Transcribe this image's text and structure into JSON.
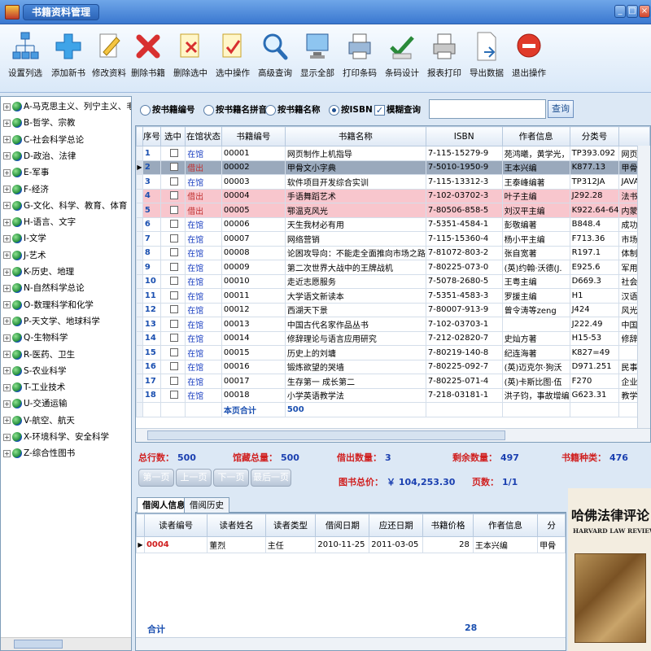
{
  "window": {
    "title": "书籍资料管理"
  },
  "toolbar": [
    {
      "label": "设置列选",
      "icon": "column-settings-icon"
    },
    {
      "label": "添加新书",
      "icon": "add-icon"
    },
    {
      "label": "修改资料",
      "icon": "edit-icon"
    },
    {
      "label": "删除书籍",
      "icon": "delete-icon"
    },
    {
      "label": "删除选中",
      "icon": "delete-selected-icon"
    },
    {
      "label": "选中操作",
      "icon": "check-operation-icon"
    },
    {
      "label": "高级查询",
      "icon": "search-icon"
    },
    {
      "label": "显示全部",
      "icon": "show-all-icon"
    },
    {
      "label": "打印条码",
      "icon": "print-barcode-icon"
    },
    {
      "label": "条码设计",
      "icon": "barcode-design-icon"
    },
    {
      "label": "报表打印",
      "icon": "report-print-icon"
    },
    {
      "label": "导出数据",
      "icon": "export-icon"
    },
    {
      "label": "退出操作",
      "icon": "exit-icon"
    }
  ],
  "tree": [
    "A-马克思主义、列宁主义、毛",
    "B-哲学、宗教",
    "C-社会科学总论",
    "D-政治、法律",
    "E-军事",
    "F-经济",
    "G-文化、科学、教育、体育",
    "H-语言、文字",
    "I-文学",
    "J-艺术",
    "K-历史、地理",
    "N-自然科学总论",
    "O-数理科学和化学",
    "P-天文学、地球科学",
    "Q-生物科学",
    "R-医药、卫生",
    "S-农业科学",
    "T-工业技术",
    "U-交通运输",
    "V-航空、航天",
    "X-环境科学、安全科学",
    "Z-综合性图书"
  ],
  "search": {
    "options": [
      "按书籍编号",
      "按书籍名拼音",
      "按书籍名称",
      "按ISBN"
    ],
    "selected": 3,
    "fuzzy_label": "模糊查询",
    "fuzzy_checked": true,
    "input_value": "",
    "button": "查询"
  },
  "grid": {
    "columns": [
      "序号",
      "选中",
      "在馆状态",
      "书籍编号",
      "书籍名称",
      "ISBN",
      "作者信息",
      "分类号",
      ""
    ],
    "rows": [
      {
        "seq": "1",
        "status": "在馆",
        "id": "00001",
        "name": "网页制作上机指导",
        "isbn": "7-115-15279-9",
        "author": "苑鸿曦，黄学光，",
        "cls": "TP393.092",
        "extra": "网页"
      },
      {
        "seq": "2",
        "status": "借出",
        "id": "00002",
        "name": "甲骨文小字典",
        "isbn": "7-5010-1950-9",
        "author": "王本兴编",
        "cls": "K877.13",
        "extra": "甲骨"
      },
      {
        "seq": "3",
        "status": "在馆",
        "id": "00003",
        "name": "软件项目开发综合实训",
        "isbn": "7-115-13312-3",
        "author": "王泰峰编著",
        "cls": "TP312JA",
        "extra": "JAVA"
      },
      {
        "seq": "4",
        "status": "借出",
        "id": "00004",
        "name": "手语舞蹈艺术",
        "isbn": "7-102-03702-3",
        "author": "叶子主编",
        "cls": "J292.28",
        "extra": "法书"
      },
      {
        "seq": "5",
        "status": "借出",
        "id": "00005",
        "name": "鄂温克风光",
        "isbn": "7-80506-858-5",
        "author": "刘汉平主编",
        "cls": "K922.64-64",
        "extra": "内蒙"
      },
      {
        "seq": "6",
        "status": "在馆",
        "id": "00006",
        "name": "天生我材必有用",
        "isbn": "7-5351-4584-1",
        "author": "彭敬编著",
        "cls": "B848.4",
        "extra": "成功"
      },
      {
        "seq": "7",
        "status": "在馆",
        "id": "00007",
        "name": "网络营销",
        "isbn": "7-115-15360-4",
        "author": "杨小平主编",
        "cls": "F713.36",
        "extra": "市场"
      },
      {
        "seq": "8",
        "status": "在馆",
        "id": "00008",
        "name": "论困攻导向：不能走全面推向市场之路",
        "isbn": "7-81072-803-2",
        "author": "张自宽著",
        "cls": "R197.1",
        "extra": "体制"
      },
      {
        "seq": "9",
        "status": "在馆",
        "id": "00009",
        "name": "第二次世界大战中的王牌战机",
        "isbn": "7-80225-073-0",
        "author": "(英)约翰·沃德(J.",
        "cls": "E925.6",
        "extra": "军用"
      },
      {
        "seq": "10",
        "status": "在馆",
        "id": "00010",
        "name": "走近志愿服务",
        "isbn": "7-5078-2680-5",
        "author": "王粤主编",
        "cls": "D669.3",
        "extra": "社会"
      },
      {
        "seq": "11",
        "status": "在馆",
        "id": "00011",
        "name": "大学语文新读本",
        "isbn": "7-5351-4583-3",
        "author": "罗援主编",
        "cls": "H1",
        "extra": "汉语"
      },
      {
        "seq": "12",
        "status": "在馆",
        "id": "00012",
        "name": "西湖天下景",
        "isbn": "7-80007-913-9",
        "author": "曾令涛等zeng",
        "cls": "J424",
        "extra": "风光"
      },
      {
        "seq": "13",
        "status": "在馆",
        "id": "00013",
        "name": "中国古代名家作品丛书",
        "isbn": "7-102-03703-1",
        "author": "",
        "cls": "J222.49",
        "extra": "中国"
      },
      {
        "seq": "14",
        "status": "在馆",
        "id": "00014",
        "name": "修辞理论与语言应用研究",
        "isbn": "7-212-02820-7",
        "author": "史灿方著",
        "cls": "H15-53",
        "extra": "修辞"
      },
      {
        "seq": "15",
        "status": "在馆",
        "id": "00015",
        "name": "历史上的刘墉",
        "isbn": "7-80219-140-8",
        "author": "纪连海著",
        "cls": "K827=49",
        "extra": ""
      },
      {
        "seq": "16",
        "status": "在馆",
        "id": "00016",
        "name": "锻炼欲望的哭墙",
        "isbn": "7-80225-092-7",
        "author": "(英)迈克尔·狗沃",
        "cls": "D971.251",
        "extra": "民事"
      },
      {
        "seq": "17",
        "status": "在馆",
        "id": "00017",
        "name": "生存第一 成长第二",
        "isbn": "7-80225-071-4",
        "author": "(英)卡斯比图·伍",
        "cls": "F270",
        "extra": "企业"
      },
      {
        "seq": "18",
        "status": "在馆",
        "id": "00018",
        "name": "小学英语教学法",
        "isbn": "7-218-03181-1",
        "author": "洪子钧，事故增编",
        "cls": "G623.31",
        "extra": "教学"
      }
    ],
    "total_label": "本页合计",
    "total_value": "500"
  },
  "stats": {
    "total_rows_label": "总行数：",
    "total_rows": "500",
    "collection_label": "馆藏总量：",
    "collection": "500",
    "lent_label": "借出数量：",
    "lent": "3",
    "remaining_label": "剩余数量：",
    "remaining": "497",
    "kinds_label": "书籍种类：",
    "kinds": "476",
    "price_label": "图书总价：",
    "price": "￥ 104,253.30",
    "pages_label": "页数：",
    "pages": "1/1"
  },
  "pager": [
    "第一页",
    "上一页",
    "下一页",
    "最后一页"
  ],
  "tabs": [
    "借阅人信息",
    "借阅历史"
  ],
  "borrow": {
    "columns": [
      "读者编号",
      "读者姓名",
      "读者类型",
      "借阅日期",
      "应还日期",
      "书籍价格",
      "作者信息",
      "分"
    ],
    "rows": [
      {
        "reader_id": "0004",
        "name": "董烈",
        "type": "主任",
        "borrow_date": "2010-11-25",
        "due_date": "2011-03-05",
        "price": "28",
        "author": "王本兴编",
        "cls": "甲骨"
      }
    ],
    "total_label": "合计",
    "total_value": "28"
  },
  "cover": {
    "title_cn": "哈佛法律评论",
    "title_en": "HARVARD LAW REVIEW"
  }
}
